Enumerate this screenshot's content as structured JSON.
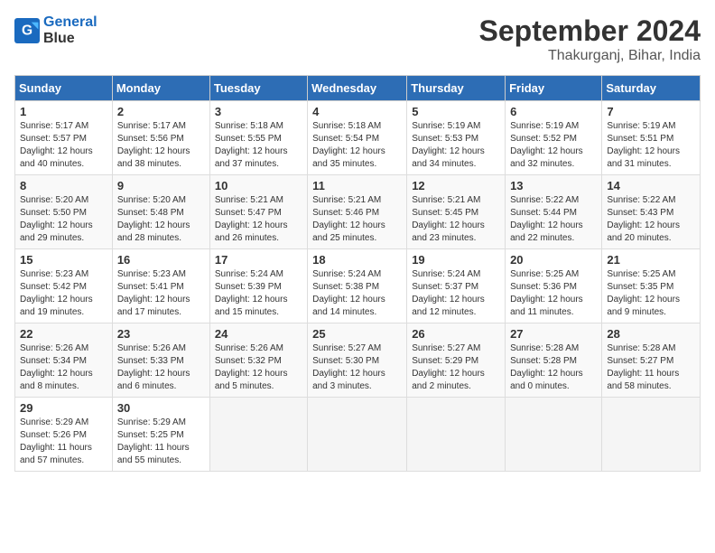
{
  "header": {
    "logo_line1": "General",
    "logo_line2": "Blue",
    "month": "September 2024",
    "location": "Thakurganj, Bihar, India"
  },
  "weekdays": [
    "Sunday",
    "Monday",
    "Tuesday",
    "Wednesday",
    "Thursday",
    "Friday",
    "Saturday"
  ],
  "weeks": [
    [
      {
        "day": "1",
        "lines": [
          "Sunrise: 5:17 AM",
          "Sunset: 5:57 PM",
          "Daylight: 12 hours",
          "and 40 minutes."
        ]
      },
      {
        "day": "2",
        "lines": [
          "Sunrise: 5:17 AM",
          "Sunset: 5:56 PM",
          "Daylight: 12 hours",
          "and 38 minutes."
        ]
      },
      {
        "day": "3",
        "lines": [
          "Sunrise: 5:18 AM",
          "Sunset: 5:55 PM",
          "Daylight: 12 hours",
          "and 37 minutes."
        ]
      },
      {
        "day": "4",
        "lines": [
          "Sunrise: 5:18 AM",
          "Sunset: 5:54 PM",
          "Daylight: 12 hours",
          "and 35 minutes."
        ]
      },
      {
        "day": "5",
        "lines": [
          "Sunrise: 5:19 AM",
          "Sunset: 5:53 PM",
          "Daylight: 12 hours",
          "and 34 minutes."
        ]
      },
      {
        "day": "6",
        "lines": [
          "Sunrise: 5:19 AM",
          "Sunset: 5:52 PM",
          "Daylight: 12 hours",
          "and 32 minutes."
        ]
      },
      {
        "day": "7",
        "lines": [
          "Sunrise: 5:19 AM",
          "Sunset: 5:51 PM",
          "Daylight: 12 hours",
          "and 31 minutes."
        ]
      }
    ],
    [
      {
        "day": "8",
        "lines": [
          "Sunrise: 5:20 AM",
          "Sunset: 5:50 PM",
          "Daylight: 12 hours",
          "and 29 minutes."
        ]
      },
      {
        "day": "9",
        "lines": [
          "Sunrise: 5:20 AM",
          "Sunset: 5:48 PM",
          "Daylight: 12 hours",
          "and 28 minutes."
        ]
      },
      {
        "day": "10",
        "lines": [
          "Sunrise: 5:21 AM",
          "Sunset: 5:47 PM",
          "Daylight: 12 hours",
          "and 26 minutes."
        ]
      },
      {
        "day": "11",
        "lines": [
          "Sunrise: 5:21 AM",
          "Sunset: 5:46 PM",
          "Daylight: 12 hours",
          "and 25 minutes."
        ]
      },
      {
        "day": "12",
        "lines": [
          "Sunrise: 5:21 AM",
          "Sunset: 5:45 PM",
          "Daylight: 12 hours",
          "and 23 minutes."
        ]
      },
      {
        "day": "13",
        "lines": [
          "Sunrise: 5:22 AM",
          "Sunset: 5:44 PM",
          "Daylight: 12 hours",
          "and 22 minutes."
        ]
      },
      {
        "day": "14",
        "lines": [
          "Sunrise: 5:22 AM",
          "Sunset: 5:43 PM",
          "Daylight: 12 hours",
          "and 20 minutes."
        ]
      }
    ],
    [
      {
        "day": "15",
        "lines": [
          "Sunrise: 5:23 AM",
          "Sunset: 5:42 PM",
          "Daylight: 12 hours",
          "and 19 minutes."
        ]
      },
      {
        "day": "16",
        "lines": [
          "Sunrise: 5:23 AM",
          "Sunset: 5:41 PM",
          "Daylight: 12 hours",
          "and 17 minutes."
        ]
      },
      {
        "day": "17",
        "lines": [
          "Sunrise: 5:24 AM",
          "Sunset: 5:39 PM",
          "Daylight: 12 hours",
          "and 15 minutes."
        ]
      },
      {
        "day": "18",
        "lines": [
          "Sunrise: 5:24 AM",
          "Sunset: 5:38 PM",
          "Daylight: 12 hours",
          "and 14 minutes."
        ]
      },
      {
        "day": "19",
        "lines": [
          "Sunrise: 5:24 AM",
          "Sunset: 5:37 PM",
          "Daylight: 12 hours",
          "and 12 minutes."
        ]
      },
      {
        "day": "20",
        "lines": [
          "Sunrise: 5:25 AM",
          "Sunset: 5:36 PM",
          "Daylight: 12 hours",
          "and 11 minutes."
        ]
      },
      {
        "day": "21",
        "lines": [
          "Sunrise: 5:25 AM",
          "Sunset: 5:35 PM",
          "Daylight: 12 hours",
          "and 9 minutes."
        ]
      }
    ],
    [
      {
        "day": "22",
        "lines": [
          "Sunrise: 5:26 AM",
          "Sunset: 5:34 PM",
          "Daylight: 12 hours",
          "and 8 minutes."
        ]
      },
      {
        "day": "23",
        "lines": [
          "Sunrise: 5:26 AM",
          "Sunset: 5:33 PM",
          "Daylight: 12 hours",
          "and 6 minutes."
        ]
      },
      {
        "day": "24",
        "lines": [
          "Sunrise: 5:26 AM",
          "Sunset: 5:32 PM",
          "Daylight: 12 hours",
          "and 5 minutes."
        ]
      },
      {
        "day": "25",
        "lines": [
          "Sunrise: 5:27 AM",
          "Sunset: 5:30 PM",
          "Daylight: 12 hours",
          "and 3 minutes."
        ]
      },
      {
        "day": "26",
        "lines": [
          "Sunrise: 5:27 AM",
          "Sunset: 5:29 PM",
          "Daylight: 12 hours",
          "and 2 minutes."
        ]
      },
      {
        "day": "27",
        "lines": [
          "Sunrise: 5:28 AM",
          "Sunset: 5:28 PM",
          "Daylight: 12 hours",
          "and 0 minutes."
        ]
      },
      {
        "day": "28",
        "lines": [
          "Sunrise: 5:28 AM",
          "Sunset: 5:27 PM",
          "Daylight: 11 hours",
          "and 58 minutes."
        ]
      }
    ],
    [
      {
        "day": "29",
        "lines": [
          "Sunrise: 5:29 AM",
          "Sunset: 5:26 PM",
          "Daylight: 11 hours",
          "and 57 minutes."
        ]
      },
      {
        "day": "30",
        "lines": [
          "Sunrise: 5:29 AM",
          "Sunset: 5:25 PM",
          "Daylight: 11 hours",
          "and 55 minutes."
        ]
      },
      {
        "day": "",
        "lines": []
      },
      {
        "day": "",
        "lines": []
      },
      {
        "day": "",
        "lines": []
      },
      {
        "day": "",
        "lines": []
      },
      {
        "day": "",
        "lines": []
      }
    ]
  ]
}
